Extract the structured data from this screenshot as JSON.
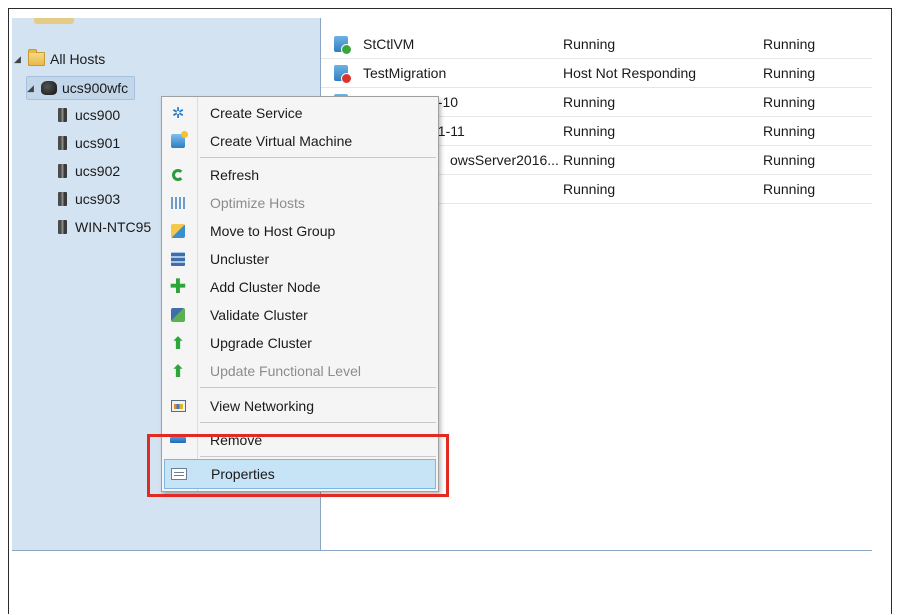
{
  "tree": {
    "root": {
      "label": "All Hosts"
    },
    "cluster": {
      "label": "ucs900wfc"
    },
    "hosts": [
      {
        "label": "ucs900"
      },
      {
        "label": "ucs901"
      },
      {
        "label": "ucs902"
      },
      {
        "label": "ucs903"
      },
      {
        "label": "WIN-NTC95"
      }
    ]
  },
  "vm_list": {
    "rows": [
      {
        "name": "StCtlVM",
        "status": "Running",
        "state": "Running",
        "icon": "vm-running-icon"
      },
      {
        "name": "TestMigration",
        "status": "Host Not Responding",
        "state": "Running",
        "icon": "vm-error-icon"
      },
      {
        "name": "2-10",
        "status": "Running",
        "state": "Running",
        "icon": "vm-running-icon"
      },
      {
        "name": "01-11",
        "status": "Running",
        "state": "Running",
        "icon": "vm-running-icon"
      },
      {
        "name": "owsServer2016...",
        "status": "Running",
        "state": "Running",
        "icon": "vm-running-icon"
      },
      {
        "name": "",
        "status": "Running",
        "state": "Running",
        "icon": "vm-running-icon"
      }
    ]
  },
  "context_menu": {
    "items": [
      {
        "label": "Create Service",
        "icon": "create-service-icon",
        "enabled": true
      },
      {
        "label": "Create Virtual Machine",
        "icon": "create-vm-icon",
        "enabled": true
      },
      {
        "label": "Refresh",
        "icon": "refresh-icon",
        "enabled": true
      },
      {
        "label": "Optimize Hosts",
        "icon": "optimize-hosts-icon",
        "enabled": false
      },
      {
        "label": "Move to Host Group",
        "icon": "move-host-group-icon",
        "enabled": true
      },
      {
        "label": "Uncluster",
        "icon": "uncluster-icon",
        "enabled": true
      },
      {
        "label": "Add Cluster Node",
        "icon": "add-node-icon",
        "enabled": true
      },
      {
        "label": "Validate Cluster",
        "icon": "validate-cluster-icon",
        "enabled": true
      },
      {
        "label": "Upgrade Cluster",
        "icon": "upgrade-cluster-icon",
        "enabled": true
      },
      {
        "label": "Update Functional Level",
        "icon": "update-level-icon",
        "enabled": false
      },
      {
        "label": "View Networking",
        "icon": "view-networking-icon",
        "enabled": true
      },
      {
        "label": "Remove",
        "icon": "remove-icon",
        "enabled": true
      },
      {
        "label": "Properties",
        "icon": "properties-icon",
        "enabled": true,
        "highlighted": true
      }
    ]
  },
  "colors": {
    "tree_background": "#d4e3f1",
    "highlight": "#c7e3f6",
    "callout_border": "#e12a23"
  }
}
